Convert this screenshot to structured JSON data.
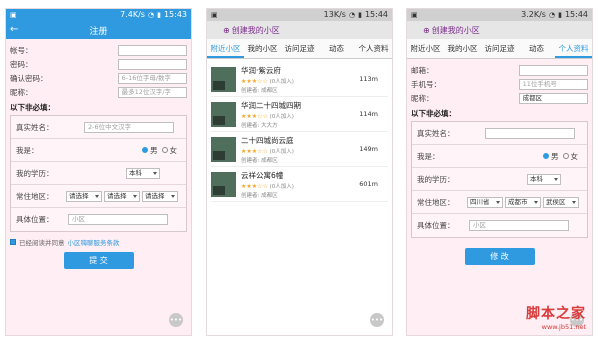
{
  "screen1": {
    "status": {
      "speed": "7.4K/s",
      "time": "15:43"
    },
    "title": "注册",
    "fields": [
      {
        "label": "帐号：",
        "placeholder": ""
      },
      {
        "label": "密码：",
        "placeholder": ""
      },
      {
        "label": "确认密码：",
        "placeholder": "6-16位字母/数字"
      },
      {
        "label": "昵称：",
        "placeholder": "最多12位汉字/字"
      }
    ],
    "section": "以下非必填：",
    "realname": {
      "label": "真实姓名：",
      "placeholder": "2-6位中文汉字"
    },
    "gender": {
      "label": "我是：",
      "male": "男",
      "female": "女"
    },
    "education": {
      "label": "我的学历：",
      "value": "本科"
    },
    "region": {
      "label": "常住地区：",
      "s1": "请选择",
      "s2": "请选择",
      "s3": "请选择"
    },
    "location": {
      "label": "具体位置：",
      "placeholder": "小区"
    },
    "agree_text": "已经阅读并同意",
    "agree_link": "小区嗨聊服务条款",
    "submit": "提 交"
  },
  "screen2": {
    "status": {
      "speed": "13K/s",
      "time": "15:44"
    },
    "title": "创建我的小区",
    "tabs": [
      "附近小区",
      "我的小区",
      "访问足迹",
      "动态",
      "个人资料"
    ],
    "items": [
      {
        "name": "华润·紫云府",
        "people": "(0人加入)",
        "creator": "创建者: 成都区",
        "distance": "113m"
      },
      {
        "name": "华润二十四城四期",
        "people": "(0人加入)",
        "creator": "创建者: 大大方",
        "distance": "114m"
      },
      {
        "name": "二十四城尚云庭",
        "people": "(0人加入)",
        "creator": "创建者: 成都区",
        "distance": "149m"
      },
      {
        "name": "云祥公寓6幢",
        "people": "(0人加入)",
        "creator": "创建者: 成都区",
        "distance": "601m"
      }
    ]
  },
  "screen3": {
    "status": {
      "speed": "3.2K/s",
      "time": "15:44"
    },
    "title": "创建我的小区",
    "tabs": [
      "附近小区",
      "我的小区",
      "访问足迹",
      "动态",
      "个人资料"
    ],
    "email_label": "邮箱：",
    "phone_label": "手机号：",
    "phone_placeholder": "11位手机号",
    "nick_label": "昵称：",
    "nick_value": "成都区",
    "section": "以下非必填：",
    "realname_label": "真实姓名：",
    "gender": {
      "label": "我是：",
      "male": "男",
      "female": "女"
    },
    "education": {
      "label": "我的学历：",
      "value": "本科"
    },
    "region": {
      "label": "常住地区：",
      "s1": "四川省",
      "s2": "成都市",
      "s3": "武侯区"
    },
    "location": {
      "label": "具体位置：",
      "placeholder": "小区"
    },
    "submit": "修 改"
  },
  "watermark": {
    "main": "脚本之家",
    "sub": "www.jb51.net"
  }
}
